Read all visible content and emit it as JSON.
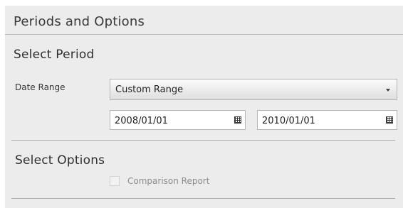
{
  "panel": {
    "title": "Periods and Options"
  },
  "select_period": {
    "heading": "Select Period",
    "date_range_label": "Date Range",
    "date_range_value": "Custom Range",
    "start_date": "2008/01/01",
    "end_date": "2010/01/01",
    "calendar_icon": "calendar-icon"
  },
  "select_options": {
    "heading": "Select Options",
    "comparison_report_label": "Comparison Report",
    "comparison_report_checked": false,
    "comparison_report_enabled": false
  },
  "colors": {
    "panel_background": "#ececec",
    "divider": "#a8a8a8",
    "disabled_text": "#8c8c8c"
  }
}
